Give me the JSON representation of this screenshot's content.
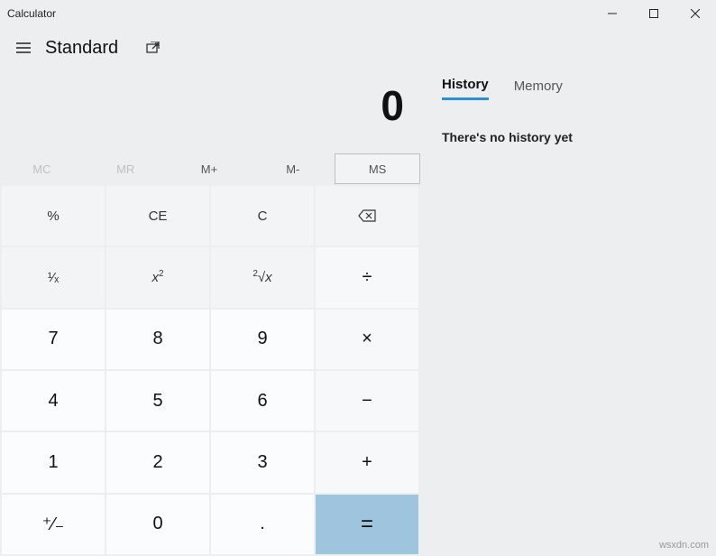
{
  "window": {
    "title": "Calculator"
  },
  "header": {
    "mode": "Standard"
  },
  "display": {
    "value": "0"
  },
  "memory_buttons": {
    "mc": "MC",
    "mr": "MR",
    "mplus": "M+",
    "mminus": "M-",
    "ms": "MS"
  },
  "keys": {
    "percent": "%",
    "ce": "CE",
    "c": "C",
    "recip": "¹⁄ₓ",
    "square": "x²",
    "sqrt": "²√x",
    "divide": "÷",
    "multiply": "×",
    "minus": "−",
    "plus": "+",
    "equals": "=",
    "negate": "⁺⁄₋",
    "dot": ".",
    "n0": "0",
    "n1": "1",
    "n2": "2",
    "n3": "3",
    "n4": "4",
    "n5": "5",
    "n6": "6",
    "n7": "7",
    "n8": "8",
    "n9": "9"
  },
  "side_panel": {
    "tabs": {
      "history": "History",
      "memory": "Memory"
    },
    "history_empty": "There's no history yet"
  },
  "watermark": "wsxdn.com"
}
